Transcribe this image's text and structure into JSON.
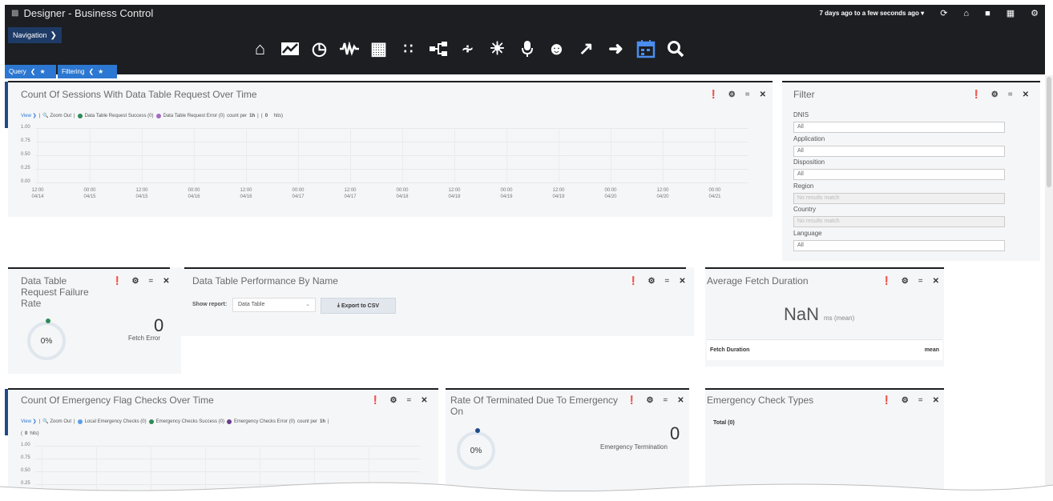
{
  "header": {
    "app_title": "Designer - Business Control",
    "nav_label": "Navigation",
    "time_range": "7 days ago to a few seconds ago",
    "tabs": [
      {
        "label": "Query"
      },
      {
        "label": "Filtering"
      }
    ]
  },
  "toolbar_icons": [
    "home-icon",
    "line-chart-icon",
    "history-icon",
    "waveform-icon",
    "calendar-grid-icon",
    "grid-icon",
    "flow-icon",
    "network-icon",
    "sun-icon",
    "microphone-icon",
    "agent-icon",
    "arrow-up-right-icon",
    "sign-in-icon",
    "calendar-active-icon",
    "search-icon"
  ],
  "top_right_icons": [
    "refresh-icon",
    "home-icon",
    "folder-icon",
    "save-icon",
    "settings-icon"
  ],
  "sessions_chart": {
    "title": "Count Of Sessions With Data Table Request Over Time",
    "view": "View",
    "zoom": "Zoom Out",
    "legend": [
      {
        "label": "Data Table Request Success (0)",
        "color": "#2e8b57"
      },
      {
        "label": "Data Table Request Error (0)",
        "color": "#a46bc4"
      }
    ],
    "count_per_prefix": "count per",
    "count_per_unit": "1h",
    "hits_prefix": "(",
    "hits_value": "0",
    "hits_suffix": "hits)",
    "y_ticks": [
      "1.00",
      "0.75",
      "0.50",
      "0.25",
      "0.00"
    ],
    "x_ticks": [
      {
        "time": "12:00",
        "date": "04/14"
      },
      {
        "time": "00:00",
        "date": "04/15"
      },
      {
        "time": "12:00",
        "date": "04/15"
      },
      {
        "time": "00:00",
        "date": "04/16"
      },
      {
        "time": "12:00",
        "date": "04/16"
      },
      {
        "time": "00:00",
        "date": "04/17"
      },
      {
        "time": "12:00",
        "date": "04/17"
      },
      {
        "time": "00:00",
        "date": "04/18"
      },
      {
        "time": "12:00",
        "date": "04/18"
      },
      {
        "time": "00:00",
        "date": "04/19"
      },
      {
        "time": "12:00",
        "date": "04/19"
      },
      {
        "time": "00:00",
        "date": "04/20"
      },
      {
        "time": "12:00",
        "date": "04/20"
      },
      {
        "time": "00:00",
        "date": "04/21"
      }
    ]
  },
  "filter": {
    "title": "Filter",
    "fields": [
      {
        "label": "DNIS",
        "value": "All",
        "disabled": false
      },
      {
        "label": "Application",
        "value": "All",
        "disabled": false
      },
      {
        "label": "Disposition",
        "value": "All",
        "disabled": false
      },
      {
        "label": "Region",
        "value": "No results match",
        "disabled": true
      },
      {
        "label": "Country",
        "value": "No results match",
        "disabled": true
      },
      {
        "label": "Language",
        "value": "All",
        "disabled": false
      }
    ]
  },
  "failure_rate": {
    "title": "Data Table Request Failure Rate",
    "percent": "0%",
    "count": "0",
    "count_label": "Fetch Error"
  },
  "performance": {
    "title": "Data Table Performance By Name",
    "show_report_label": "Show report:",
    "report_value": "Data Table",
    "export_label": "Export to CSV"
  },
  "avg_fetch": {
    "title": "Average Fetch Duration",
    "value": "NaN",
    "unit": "ms (mean)",
    "col1": "Fetch Duration",
    "col2": "mean"
  },
  "emergency_chart": {
    "title": "Count Of Emergency Flag Checks Over Time",
    "view": "View",
    "zoom": "Zoom Out",
    "legend": [
      {
        "label": "Local Emergency Checks (0)",
        "color": "#5b9ee8"
      },
      {
        "label": "Emergency Checks Success (0)",
        "color": "#2e8b57"
      },
      {
        "label": "Emergency Checks Error (0)",
        "color": "#6a3d8f"
      }
    ],
    "count_per_prefix": "count per",
    "count_per_unit": "1h",
    "hits_prefix": "(",
    "hits_value": "0",
    "hits_suffix": "hits)",
    "y_ticks": [
      "1.00",
      "0.75",
      "0.50",
      "0.25"
    ]
  },
  "terminated": {
    "title": "Rate Of Terminated Due To Emergency On",
    "percent": "0%",
    "count": "0",
    "count_label": "Emergency Termination"
  },
  "check_types": {
    "title": "Emergency Check Types",
    "total_label": "Total (0)"
  },
  "colors": {
    "topbar": "#1c1e22",
    "accent": "#2b77d1",
    "panel_bg": "#f5f6f8"
  }
}
